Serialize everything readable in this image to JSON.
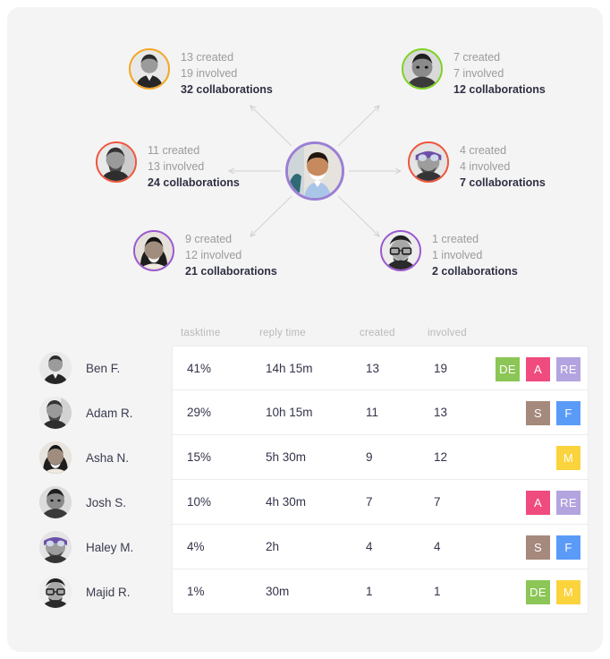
{
  "network": {
    "center": {
      "name": "center-user",
      "ring_color": "#9b7fd4"
    },
    "nodes": [
      {
        "id": "ben",
        "ring_color": "#f5a623",
        "created": "13 created",
        "involved": "19 involved",
        "collaborations": "32 collaborations"
      },
      {
        "id": "josh",
        "ring_color": "#7ed321",
        "created": "7 created",
        "involved": "7 involved",
        "collaborations": "12 collaborations"
      },
      {
        "id": "adam",
        "ring_color": "#f0553c",
        "created": "11 created",
        "involved": "13 involved",
        "collaborations": "24 collaborations"
      },
      {
        "id": "haley",
        "ring_color": "#f0553c",
        "created": "4 created",
        "involved": "4 involved",
        "collaborations": "7 collaborations"
      },
      {
        "id": "asha",
        "ring_color": "#9b59d0",
        "created": "9 created",
        "involved": "12 involved",
        "collaborations": "21 collaborations"
      },
      {
        "id": "majid",
        "ring_color": "#9b59d0",
        "created": "1 created",
        "involved": "1 involved",
        "collaborations": "2 collaborations"
      }
    ]
  },
  "table": {
    "headers": {
      "tasktime": "tasktime",
      "reply_time": "reply time",
      "created": "created",
      "involved": "involved"
    },
    "rows": [
      {
        "name": "Ben F.",
        "tasktime": "41%",
        "reply_time": "14h 15m",
        "created": "13",
        "involved": "19",
        "tags": [
          {
            "label": "DE",
            "color": "#8cc656"
          },
          {
            "label": "A",
            "color": "#ef4b7f"
          },
          {
            "label": "RE",
            "color": "#b3a4e0"
          }
        ]
      },
      {
        "name": "Adam R.",
        "tasktime": "29%",
        "reply_time": "10h 15m",
        "created": "11",
        "involved": "13",
        "tags": [
          {
            "label": "S",
            "color": "#a5897c"
          },
          {
            "label": "F",
            "color": "#5b9bf8"
          }
        ]
      },
      {
        "name": "Asha N.",
        "tasktime": "15%",
        "reply_time": "5h 30m",
        "created": "9",
        "involved": "12",
        "tags": [
          {
            "label": "M",
            "color": "#fbd33c"
          }
        ]
      },
      {
        "name": "Josh S.",
        "tasktime": "10%",
        "reply_time": "4h 30m",
        "created": "7",
        "involved": "7",
        "tags": [
          {
            "label": "A",
            "color": "#ef4b7f"
          },
          {
            "label": "RE",
            "color": "#b3a4e0"
          }
        ]
      },
      {
        "name": "Haley M.",
        "tasktime": "4%",
        "reply_time": "2h",
        "created": "4",
        "involved": "4",
        "tags": [
          {
            "label": "S",
            "color": "#a5897c"
          },
          {
            "label": "F",
            "color": "#5b9bf8"
          }
        ]
      },
      {
        "name": "Majid R.",
        "tasktime": "1%",
        "reply_time": "30m",
        "created": "1",
        "involved": "1",
        "tags": [
          {
            "label": "DE",
            "color": "#8cc656"
          },
          {
            "label": "M",
            "color": "#fbd33c"
          }
        ]
      }
    ]
  }
}
